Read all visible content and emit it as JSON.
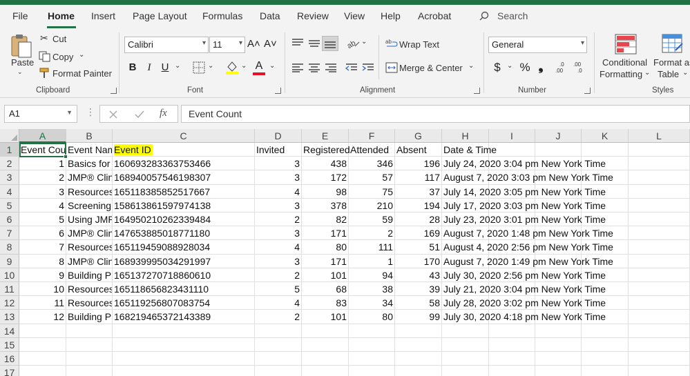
{
  "menu": [
    "File",
    "Home",
    "Insert",
    "Page Layout",
    "Formulas",
    "Data",
    "Review",
    "View",
    "Help",
    "Acrobat"
  ],
  "search_label": "Search",
  "ribbon": {
    "paste": "Paste",
    "cut": "Cut",
    "copy": "Copy",
    "format_painter": "Format Painter",
    "font_name": "Calibri",
    "font_size": "11",
    "wrap_text": "Wrap Text",
    "merge_center": "Merge & Center",
    "number_format": "General",
    "cond_fmt_1": "Conditional",
    "cond_fmt_2": "Formatting",
    "format_as_1": "Format as",
    "format_as_2": "Table",
    "groups": {
      "clipboard": "Clipboard",
      "font": "Font",
      "alignment": "Alignment",
      "number": "Number",
      "styles": "Styles"
    },
    "bold": "B",
    "italic": "I",
    "underline": "U",
    "currency": "$",
    "percent": "%",
    "comma": "❟",
    "font_grow": "A˄",
    "font_shrink": "A˅",
    "font_color_letter": "A",
    "inc_dec_1": ".00",
    "inc_dec_2": ".0",
    "dec_dec_1": ".00",
    "dec_dec_2": ".0"
  },
  "formula_bar": {
    "name_box": "A1",
    "content": "Event Count",
    "fx": "fx"
  },
  "columns": [
    "A",
    "B",
    "C",
    "D",
    "E",
    "F",
    "G",
    "H",
    "I",
    "J",
    "K",
    "L"
  ],
  "row_numbers": [
    "1",
    "2",
    "3",
    "4",
    "5",
    "6",
    "7",
    "8",
    "9",
    "10",
    "11",
    "12",
    "13",
    "14",
    "15",
    "16",
    "17"
  ],
  "header_row": [
    "Event Cou",
    "Event Nam",
    "Event ID",
    "Invited",
    "Registered",
    "Attended",
    "Absent",
    "Date & Time"
  ],
  "rows": [
    [
      "1",
      "Basics for",
      "160693283363753466",
      "3",
      "438",
      "346",
      "196",
      "July 24, 2020 3:04 pm New York Time"
    ],
    [
      "2",
      "JMP® Clini",
      "168940057546198307",
      "3",
      "172",
      "57",
      "117",
      "August 7, 2020 3:03 pm New York Time"
    ],
    [
      "3",
      "Resources",
      "165118385852517667",
      "4",
      "98",
      "75",
      "37",
      "July 14, 2020 3:05 pm New York Time"
    ],
    [
      "4",
      "Screening",
      "158613861597974138",
      "3",
      "378",
      "210",
      "194",
      "July 17, 2020 3:03 pm New York Time"
    ],
    [
      "5",
      "Using JMP",
      "164950210262339484",
      "2",
      "82",
      "59",
      "28",
      "July 23, 2020 3:01 pm New York Time"
    ],
    [
      "6",
      "JMP® Clini",
      "147653885018771180",
      "3",
      "171",
      "2",
      "169",
      "August 7, 2020 1:48 pm New York Time"
    ],
    [
      "7",
      "Resources",
      "165119459088928034",
      "4",
      "80",
      "111",
      "51",
      "August 4, 2020 2:56 pm New York Time"
    ],
    [
      "8",
      "JMP® Clini",
      "168939995034291997",
      "3",
      "171",
      "1",
      "170",
      "August 7, 2020 1:49 pm New York Time"
    ],
    [
      "9",
      "Building Pr",
      "165137270718860610",
      "2",
      "101",
      "94",
      "43",
      "July 30, 2020 2:56 pm New York Time"
    ],
    [
      "10",
      "Resources",
      "165118656823431110",
      "5",
      "68",
      "38",
      "39",
      "July 21, 2020 3:04 pm New York Time"
    ],
    [
      "11",
      "Resources",
      "165119256807083754",
      "4",
      "83",
      "34",
      "58",
      "July 28, 2020 3:02 pm New York Time"
    ],
    [
      "12",
      "Building Pr",
      "168219465372143389",
      "2",
      "101",
      "80",
      "99",
      "July 30, 2020 4:18 pm New York Time"
    ]
  ],
  "colors": {
    "excel_green": "#217346",
    "highlight": "#ffff00",
    "font_color_red": "#e81123"
  }
}
